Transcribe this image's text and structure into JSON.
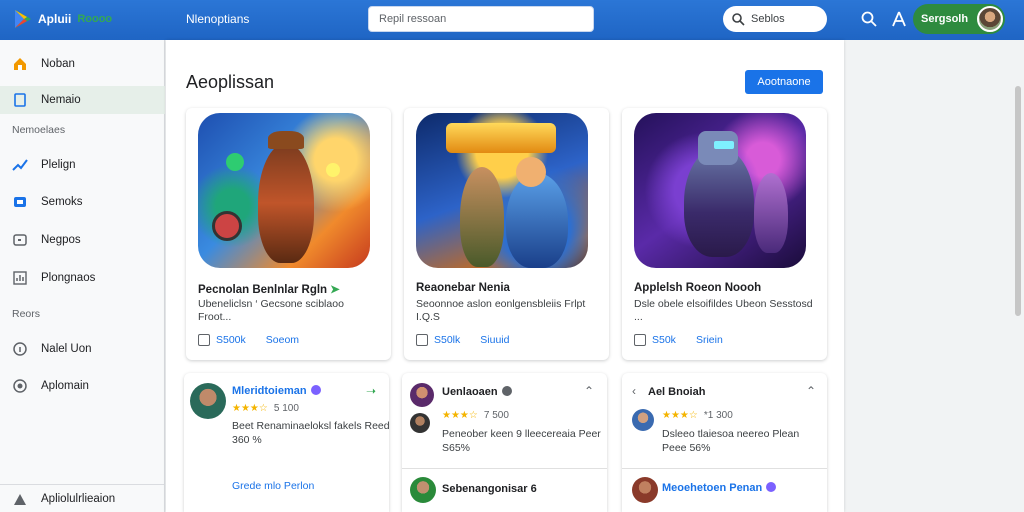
{
  "header": {
    "logo_text": "Apluii",
    "logo_accent": "Roooo",
    "app_title": "Nlenoptians",
    "search_placeholder": "Repil ressoan",
    "search_right_label": "Seblos",
    "user_name": "Sergsolh"
  },
  "sidebar": {
    "items": [
      {
        "label": "Noban",
        "icon": "home-icon"
      },
      {
        "label": "Nemaio",
        "icon": "bookmark-icon"
      }
    ],
    "section1": "Nemoelaes",
    "items2": [
      {
        "label": "Plelign",
        "icon": "trending-icon"
      },
      {
        "label": "Semoks",
        "icon": "games-icon"
      },
      {
        "label": "Negpos",
        "icon": "video-icon"
      },
      {
        "label": "Plongnaos",
        "icon": "chart-icon"
      }
    ],
    "section2": "Reors",
    "items3": [
      {
        "label": "Nalel Uon",
        "icon": "info-icon"
      },
      {
        "label": "Aplomain",
        "icon": "settings-icon"
      }
    ],
    "footer": "Apliolulrlieaion"
  },
  "main": {
    "title": "Aeoplissan",
    "action_button": "Aootnaone",
    "cards": [
      {
        "title": "Pecnolan Benlnlar Rgln",
        "desc": "Ubeneliclsn ‘ Gecsone sciblaoo Froot...",
        "action1": "S500k",
        "action2": "Soeom"
      },
      {
        "title": "Reaonebar Nenia",
        "desc": "Seoonnoe aslon eonlgensbleiis Frlpt I.Q.S",
        "action1": "S50lk",
        "action2": "Siuuid"
      },
      {
        "title": "Applelsh Roeon Noooh",
        "desc": "Dsle obele elsoifildes Ubeon Sesstosd ...",
        "action1": "S50k",
        "action2": "Sriein"
      }
    ],
    "reviews": [
      {
        "name": "Mleridtoieman",
        "stars": "★★★☆",
        "count": "5 100",
        "text": "Beet Renaminaeloksl fakels Reed 360 %",
        "link": "Grede mlo Perlon"
      },
      {
        "name": "Uenlaoaen",
        "stars": "★★★☆",
        "count": "7 500",
        "text": "Peneober keen 9 lleecereaia Peer S65%",
        "name2": "Sebenangonisar 6"
      },
      {
        "name": "Ael Bnoiah",
        "stars": "★★★☆",
        "count": "*1 300",
        "text": "Dsleeo tlaiesoa neereo Plean Peee 56%",
        "name2": "Meoehetoen Penan"
      }
    ]
  }
}
